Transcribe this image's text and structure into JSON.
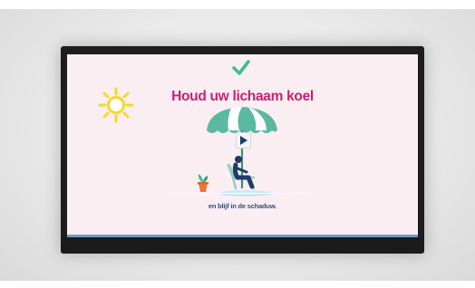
{
  "video": {
    "title": "Houd uw lichaam koel",
    "caption": "en blijf in de schaduw."
  },
  "colors": {
    "title": "#cc1f6e",
    "caption": "#2e4f8a",
    "accent_green": "#3dbd93",
    "umbrella_teal": "#5bb9a2",
    "person_navy": "#1f3b6a",
    "sun": "#f6d82a",
    "progress": "#6f9ec4"
  },
  "icons": {
    "check": "checkmark-icon",
    "sun": "sun-icon",
    "play": "play-icon",
    "umbrella": "beach-umbrella-icon",
    "person": "person-in-chair-icon",
    "plant": "potted-plant-icon"
  }
}
